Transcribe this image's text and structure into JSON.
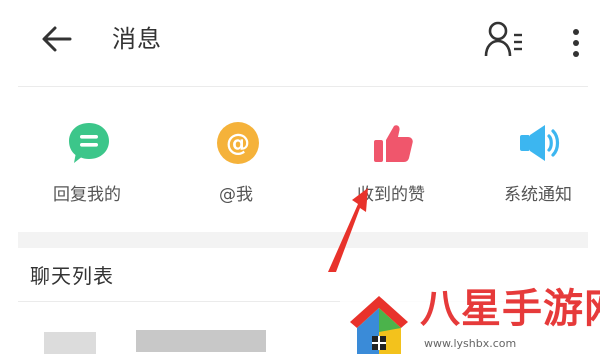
{
  "header": {
    "title": "消息",
    "back_icon": "arrow-left-icon",
    "contacts_icon": "contacts-list-icon",
    "more_icon": "more-vertical-icon"
  },
  "categories": [
    {
      "label": "回复我的",
      "icon": "chat-bubble-icon",
      "color": "#3cc68a"
    },
    {
      "label": "@我",
      "icon": "at-sign-icon",
      "color": "#f5b23a"
    },
    {
      "label": "收到的赞",
      "icon": "thumbs-up-icon",
      "color": "#f0566c"
    },
    {
      "label": "系统通知",
      "icon": "speaker-icon",
      "color": "#3cb6f0"
    }
  ],
  "chat_list": {
    "header": "聊天列表"
  },
  "overlay": {
    "arrow_color": "#e8322b"
  },
  "watermark": {
    "name": "八星手游网",
    "url": "www.lyshbx.com"
  }
}
